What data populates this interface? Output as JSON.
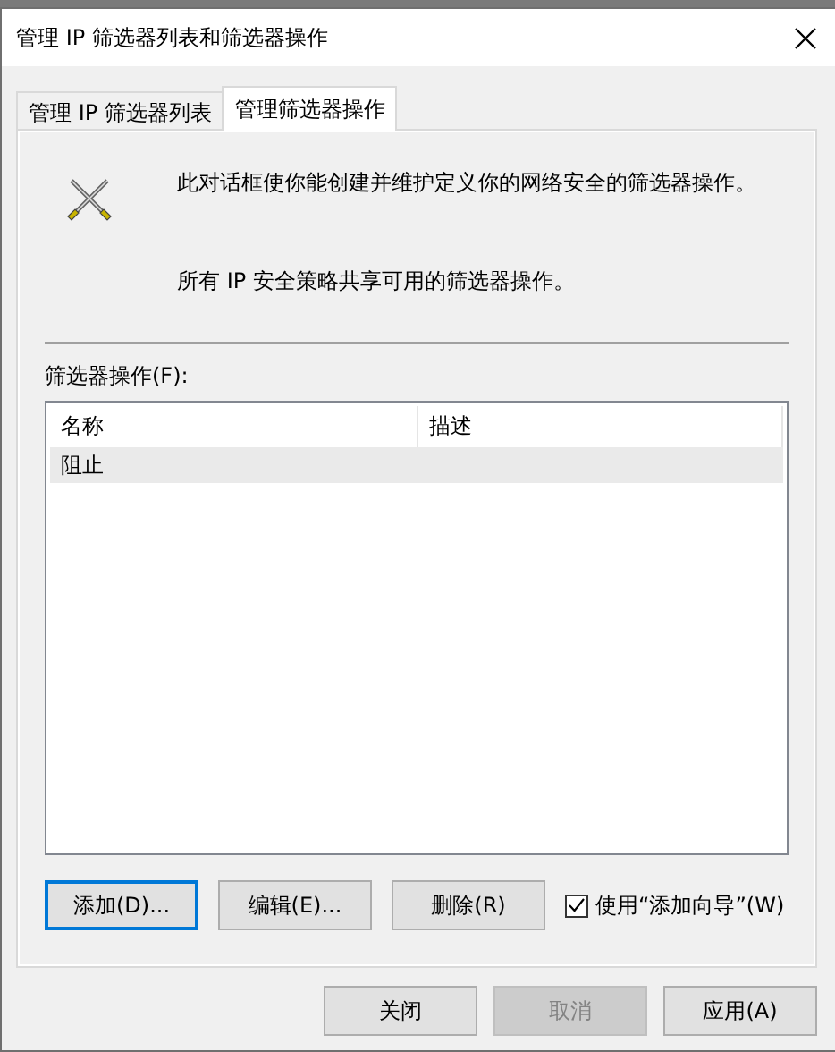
{
  "window": {
    "title": "管理 IP 筛选器列表和筛选器操作"
  },
  "tabs": [
    {
      "label": "管理 IP 筛选器列表",
      "selected": false
    },
    {
      "label": "管理筛选器操作",
      "selected": true
    }
  ],
  "description": [
    "此对话框使你能创建并维护定义你的网络安全的筛选器操作。",
    "所有 IP 安全策略共享可用的筛选器操作。"
  ],
  "list": {
    "label": "筛选器操作(F):",
    "columns": [
      "名称",
      "描述"
    ],
    "rows": [
      {
        "cells": [
          "阻止",
          ""
        ],
        "selected": true
      }
    ]
  },
  "actions": [
    {
      "label": "添加(D)...",
      "focused": true
    },
    {
      "label": "编辑(E)...",
      "focused": false
    },
    {
      "label": "删除(R)",
      "focused": false
    }
  ],
  "wizard": {
    "label": "使用“添加向导”(W)",
    "checked": true
  },
  "footer": [
    {
      "label": "关闭",
      "disabled": false
    },
    {
      "label": "取消",
      "disabled": true
    },
    {
      "label": "应用(A)",
      "disabled": false
    }
  ]
}
